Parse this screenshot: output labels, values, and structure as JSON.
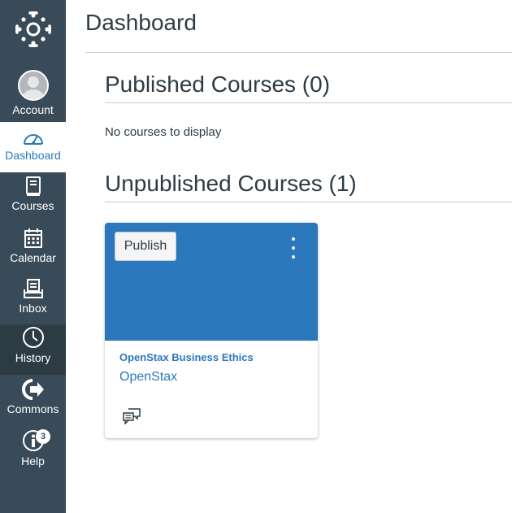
{
  "sidebar": {
    "items": [
      {
        "label": "Account",
        "icon": "avatar"
      },
      {
        "label": "Dashboard",
        "icon": "dashboard-icon",
        "active": true
      },
      {
        "label": "Courses",
        "icon": "book-icon"
      },
      {
        "label": "Calendar",
        "icon": "calendar-icon"
      },
      {
        "label": "Inbox",
        "icon": "inbox-icon"
      },
      {
        "label": "History",
        "icon": "clock-icon"
      },
      {
        "label": "Commons",
        "icon": "commons-icon"
      },
      {
        "label": "Help",
        "icon": "help-icon",
        "badge": "3"
      }
    ]
  },
  "main": {
    "title": "Dashboard",
    "published": {
      "title": "Published Courses (0)",
      "empty_text": "No courses to display"
    },
    "unpublished": {
      "title": "Unpublished Courses (1)",
      "courses": [
        {
          "name": "OpenStax Business Ethics",
          "subtitle": "OpenStax",
          "publish_label": "Publish",
          "color": "#2b78bd"
        }
      ]
    }
  },
  "colors": {
    "sidebar_bg": "#394b58",
    "sidebar_active_bg": "#ffffff",
    "accent": "#2b78bd",
    "text": "#2d3b45"
  }
}
